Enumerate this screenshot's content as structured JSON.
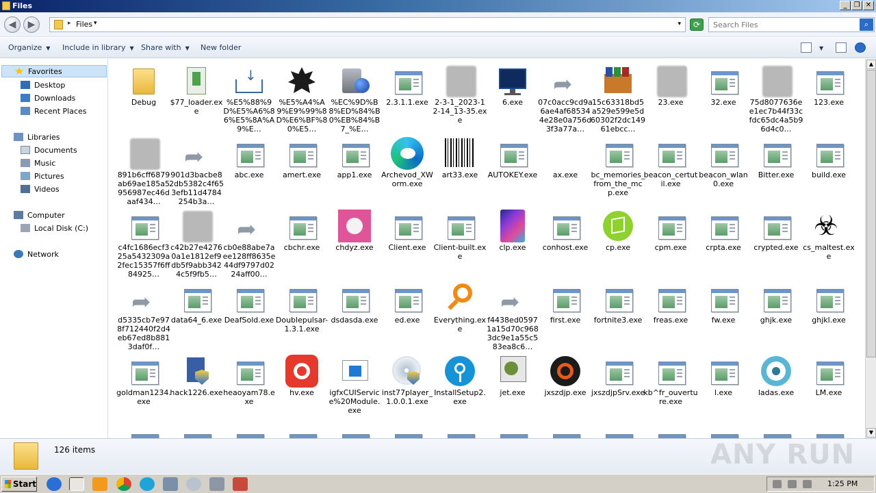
{
  "window": {
    "title": "Files",
    "min": "_",
    "max": "❐",
    "close": "✕"
  },
  "address": {
    "path": "Files",
    "sep": "▸",
    "sep2": "▾",
    "drop": "▾"
  },
  "search": {
    "placeholder": "Search Files"
  },
  "commands": {
    "organize": "Organize",
    "include": "Include in library",
    "share": "Share with",
    "newfolder": "New folder",
    "arrow": "▼"
  },
  "nav": {
    "favorites": "Favorites",
    "desktop": "Desktop",
    "downloads": "Downloads",
    "recent": "Recent Places",
    "libraries": "Libraries",
    "documents": "Documents",
    "music": "Music",
    "pictures": "Pictures",
    "videos": "Videos",
    "computer": "Computer",
    "localdisk": "Local Disk (C:)",
    "network": "Network"
  },
  "files": [
    {
      "name": "Debug",
      "icon": "folder-icon"
    },
    {
      "name": "$77_loader.exe",
      "icon": "installer-icon"
    },
    {
      "name": "%E5%88%9D%E5%A6%86%E5%8A%A9%E…",
      "icon": "download-icon"
    },
    {
      "name": "%E5%A4%A9%E9%99%8D%E6%BF%80%E5…",
      "icon": "badge-icon"
    },
    {
      "name": "%EC%9D%B8%ED%84%B0%EB%84%B7_%E…",
      "icon": "globe-server-icon"
    },
    {
      "name": "2.3.1.1.exe",
      "icon": "exe-icon"
    },
    {
      "name": "2-3-1_2023-12-14_13-35.exe",
      "icon": "blurred-icon"
    },
    {
      "name": "6.exe",
      "icon": "terminal-icon"
    },
    {
      "name": "07c0acc9cd9a6ae4af685344e28e0a756d3f3a77a…",
      "icon": "shortcut-icon"
    },
    {
      "name": "15c63318bd5a529e599e5d60302f2dc14961ebcc…",
      "icon": "archive-icon"
    },
    {
      "name": "23.exe",
      "icon": "blurred-icon"
    },
    {
      "name": "32.exe",
      "icon": "exe-icon"
    },
    {
      "name": "75d8077636ee1ec7b44f33cfdc65dc4a5b96d4c0…",
      "icon": "blurred-icon"
    },
    {
      "name": "123.exe",
      "icon": "exe-icon"
    },
    {
      "name": "891b6cff6879ab69ae185a5956987ec46daaf434…",
      "icon": "blurred-icon"
    },
    {
      "name": "901d3bacbe82db5382c4f653efb11d4784254b3a…",
      "icon": "shortcut-icon"
    },
    {
      "name": "abc.exe",
      "icon": "exe-icon"
    },
    {
      "name": "amert.exe",
      "icon": "exe-icon"
    },
    {
      "name": "app1.exe",
      "icon": "exe-icon"
    },
    {
      "name": "Archevod_XWorm.exe",
      "icon": "edge-icon"
    },
    {
      "name": "art33.exe",
      "icon": "barcode-icon"
    },
    {
      "name": "AUTOKEY.exe",
      "icon": "exe-icon"
    },
    {
      "name": "ax.exe",
      "icon": "none"
    },
    {
      "name": "bc_memories_from_the_mcp.exe",
      "icon": "exe-icon"
    },
    {
      "name": "beacon_certutil.exe",
      "icon": "exe-icon"
    },
    {
      "name": "beacon_wlan0.exe",
      "icon": "exe-icon"
    },
    {
      "name": "Bitter.exe",
      "icon": "exe-icon"
    },
    {
      "name": "build.exe",
      "icon": "exe-icon"
    },
    {
      "name": "c4fc1686ecf325a5432309a2fec15357f6ff84925…",
      "icon": "exe-icon"
    },
    {
      "name": "c42b27e42760a1e1812ef9db5f9abb3424c5f9fb5…",
      "icon": "blurred-icon"
    },
    {
      "name": "cb0e88abe7aee128ff8635e44df9797d0224aff00…",
      "icon": "shortcut-icon"
    },
    {
      "name": "cbchr.exe",
      "icon": "exe-icon"
    },
    {
      "name": "chdyz.exe",
      "icon": "pink-shield-icon"
    },
    {
      "name": "Client.exe",
      "icon": "exe-icon"
    },
    {
      "name": "Client-built.exe",
      "icon": "exe-icon"
    },
    {
      "name": "clp.exe",
      "icon": "galaxy-icon"
    },
    {
      "name": "conhost.exe",
      "icon": "exe-icon"
    },
    {
      "name": "cp.exe",
      "icon": "green-cube-icon"
    },
    {
      "name": "cpm.exe",
      "icon": "exe-icon"
    },
    {
      "name": "crpta.exe",
      "icon": "exe-icon"
    },
    {
      "name": "crypted.exe",
      "icon": "exe-icon"
    },
    {
      "name": "cs_maltest.exe",
      "icon": "biohazard-icon"
    },
    {
      "name": "d5335cb7e978f712440f2d4eb67ed8b8813daf0f…",
      "icon": "shortcut-icon"
    },
    {
      "name": "data64_6.exe",
      "icon": "exe-icon"
    },
    {
      "name": "DeafSold.exe",
      "icon": "exe-icon"
    },
    {
      "name": "Doublepulsar-1.3.1.exe",
      "icon": "exe-icon"
    },
    {
      "name": "dsdasda.exe",
      "icon": "exe-icon"
    },
    {
      "name": "ed.exe",
      "icon": "exe-icon"
    },
    {
      "name": "Everything.exe",
      "icon": "magnifier-icon"
    },
    {
      "name": "f4438ed05971a15d70c9683dc9e1a55c583ea8c6…",
      "icon": "shortcut-icon"
    },
    {
      "name": "first.exe",
      "icon": "exe-icon"
    },
    {
      "name": "fortnite3.exe",
      "icon": "exe-icon"
    },
    {
      "name": "freas.exe",
      "icon": "exe-icon"
    },
    {
      "name": "fw.exe",
      "icon": "exe-icon"
    },
    {
      "name": "ghjk.exe",
      "icon": "exe-icon"
    },
    {
      "name": "ghjkl.exe",
      "icon": "exe-icon"
    },
    {
      "name": "goldman1234.exe",
      "icon": "exe-icon"
    },
    {
      "name": "hack1226.exe",
      "icon": "setup-icon"
    },
    {
      "name": "heaoyam78.exe",
      "icon": "exe-icon"
    },
    {
      "name": "hv.exe",
      "icon": "red-camera-icon"
    },
    {
      "name": "igfxCUIService%20Module.exe",
      "icon": "window-icon"
    },
    {
      "name": "inst77player_1.0.0.1.exe",
      "icon": "disc-shield-icon"
    },
    {
      "name": "InstallSetup2.exe",
      "icon": "wifi-icon"
    },
    {
      "name": "jet.exe",
      "icon": "gear-window-icon"
    },
    {
      "name": "jxszdjp.exe",
      "icon": "orange-ring-icon"
    },
    {
      "name": "jxszdjpSrv.exe",
      "icon": "exe-icon"
    },
    {
      "name": "kb^fr_ouverture.exe",
      "icon": "exe-icon"
    },
    {
      "name": "l.exe",
      "icon": "exe-icon"
    },
    {
      "name": "ladas.exe",
      "icon": "eye-icon"
    },
    {
      "name": "LM.exe",
      "icon": "exe-icon"
    }
  ],
  "details": {
    "count": "126 items"
  },
  "watermark": "ANY RUN",
  "taskbar": {
    "start": "Start",
    "clock": "1:25 PM"
  }
}
